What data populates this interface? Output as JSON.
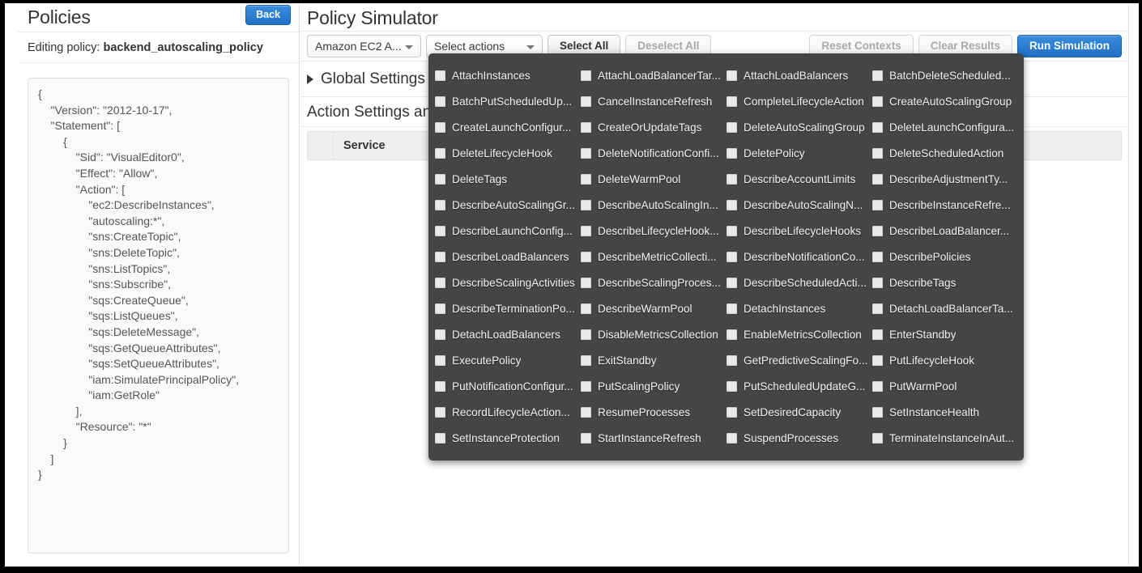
{
  "left_panel": {
    "title": "Policies",
    "back_label": "Back",
    "editing_prefix": "Editing policy:",
    "policy_name": "backend_autoscaling_policy",
    "policy_json": "{\n    \"Version\": \"2012-10-17\",\n    \"Statement\": [\n        {\n            \"Sid\": \"VisualEditor0\",\n            \"Effect\": \"Allow\",\n            \"Action\": [\n                \"ec2:DescribeInstances\",\n                \"autoscaling:*\",\n                \"sns:CreateTopic\",\n                \"sns:DeleteTopic\",\n                \"sns:ListTopics\",\n                \"sns:Subscribe\",\n                \"sqs:CreateQueue\",\n                \"sqs:ListQueues\",\n                \"sqs:DeleteMessage\",\n                \"sqs:GetQueueAttributes\",\n                \"sqs:SetQueueAttributes\",\n                \"iam:SimulatePrincipalPolicy\",\n                \"iam:GetRole\"\n            ],\n            \"Resource\": \"*\"\n        }\n    ]\n}"
  },
  "right_panel": {
    "title": "Policy Simulator",
    "service_select": "Amazon EC2 A...",
    "actions_select": "Select actions",
    "select_all_label": "Select All",
    "deselect_all_label": "Deselect All",
    "reset_contexts_label": "Reset Contexts",
    "clear_results_label": "Clear Results",
    "run_simulation_label": "Run Simulation",
    "global_settings_label": "Global Settings",
    "action_settings_label": "Action Settings and Results",
    "table_header_service": "Service"
  },
  "actions_menu": {
    "items": [
      "AttachInstances",
      "AttachLoadBalancerTar...",
      "AttachLoadBalancers",
      "BatchDeleteScheduled...",
      "BatchPutScheduledUp...",
      "CancelInstanceRefresh",
      "CompleteLifecycleAction",
      "CreateAutoScalingGroup",
      "CreateLaunchConfigur...",
      "CreateOrUpdateTags",
      "DeleteAutoScalingGroup",
      "DeleteLaunchConfigura...",
      "DeleteLifecycleHook",
      "DeleteNotificationConfi...",
      "DeletePolicy",
      "DeleteScheduledAction",
      "DeleteTags",
      "DeleteWarmPool",
      "DescribeAccountLimits",
      "DescribeAdjustmentTy...",
      "DescribeAutoScalingGr...",
      "DescribeAutoScalingIn...",
      "DescribeAutoScalingN...",
      "DescribeInstanceRefre...",
      "DescribeLaunchConfig...",
      "DescribeLifecycleHook...",
      "DescribeLifecycleHooks",
      "DescribeLoadBalancer...",
      "DescribeLoadBalancers",
      "DescribeMetricCollecti...",
      "DescribeNotificationCo...",
      "DescribePolicies",
      "DescribeScalingActivities",
      "DescribeScalingProces...",
      "DescribeScheduledActi...",
      "DescribeTags",
      "DescribeTerminationPo...",
      "DescribeWarmPool",
      "DetachInstances",
      "DetachLoadBalancerTa...",
      "DetachLoadBalancers",
      "DisableMetricsCollection",
      "EnableMetricsCollection",
      "EnterStandby",
      "ExecutePolicy",
      "ExitStandby",
      "GetPredictiveScalingFo...",
      "PutLifecycleHook",
      "PutNotificationConfigur...",
      "PutScalingPolicy",
      "PutScheduledUpdateG...",
      "PutWarmPool",
      "RecordLifecycleAction...",
      "ResumeProcesses",
      "SetDesiredCapacity",
      "SetInstanceHealth",
      "SetInstanceProtection",
      "StartInstanceRefresh",
      "SuspendProcesses",
      "TerminateInstanceInAut..."
    ]
  },
  "colors": {
    "accent_blue": "#1f6fc4",
    "menu_bg": "#454545",
    "panel_border": "#dcdcdc"
  }
}
